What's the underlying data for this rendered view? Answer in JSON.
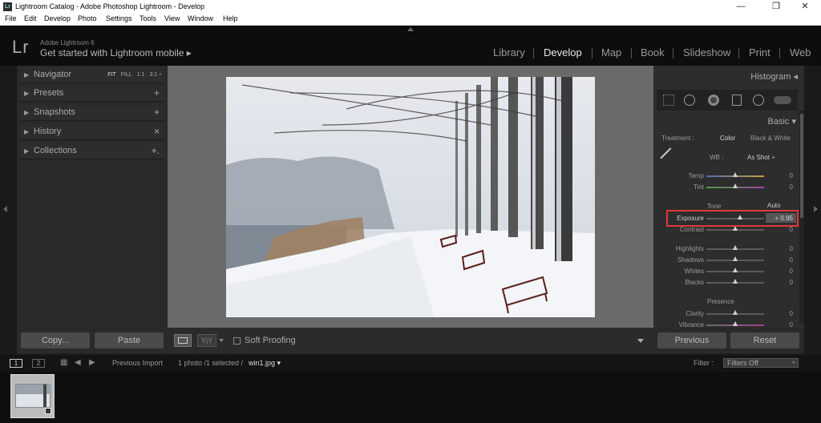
{
  "window": {
    "title": "Lightroom Catalog - Adobe Photoshop Lightroom - Develop"
  },
  "menu": [
    "File",
    "Edit",
    "Develop",
    "Photo",
    "Settings",
    "Tools",
    "View",
    "Window",
    "Help"
  ],
  "identity": {
    "logo": "Lr",
    "product": "Adobe Lightroom 6",
    "tagline": "Get started with Lightroom mobile ▸"
  },
  "modules": [
    "Library",
    "Develop",
    "Map",
    "Book",
    "Slideshow",
    "Print",
    "Web"
  ],
  "active_module": "Develop",
  "left_panel": {
    "navigator": {
      "label": "Navigator",
      "options": [
        "FIT",
        "FILL",
        "1:1",
        "3:1 ÷"
      ]
    },
    "items": [
      {
        "label": "Presets",
        "action": "+"
      },
      {
        "label": "Snapshots",
        "action": "+"
      },
      {
        "label": "History",
        "action": "×"
      },
      {
        "label": "Collections",
        "action": "+."
      }
    ],
    "copy": "Copy...",
    "paste": "Paste"
  },
  "toolbar": {
    "soft_proofing": "Soft Proofing",
    "soft_proofing_checked": false
  },
  "right_panel": {
    "histogram": "Histogram ◂",
    "basic": "Basic ▾",
    "treatment_label": "Treatment :",
    "treatment_color": "Color",
    "treatment_bw": "Black & White",
    "wb_label": "WB :",
    "wb_value": "As Shot ÷",
    "sliders": [
      {
        "label": "Temp",
        "value": "0",
        "pos": 0.5
      },
      {
        "label": "Tint",
        "value": "0",
        "pos": 0.5
      }
    ],
    "tone_label": "Tone",
    "tone_auto": "Auto",
    "exposure": {
      "label": "Exposure",
      "value": "+ 0.95",
      "pos": 0.58
    },
    "tone_sliders": [
      {
        "label": "Contrast",
        "value": "0",
        "pos": 0.5
      },
      {
        "label": "Highlights",
        "value": "0",
        "pos": 0.5
      },
      {
        "label": "Shadows",
        "value": "0",
        "pos": 0.5
      },
      {
        "label": "Whites",
        "value": "0",
        "pos": 0.5
      },
      {
        "label": "Blacks",
        "value": "0",
        "pos": 0.5
      }
    ],
    "presence_label": "Presence",
    "presence_sliders": [
      {
        "label": "Clarity",
        "value": "0",
        "pos": 0.5
      },
      {
        "label": "Vibrance",
        "value": "0",
        "pos": 0.5
      }
    ],
    "previous": "Previous",
    "reset": "Reset"
  },
  "filmstrip": {
    "screen1": "1",
    "screen2": "2",
    "source": "Previous Import",
    "count": "1 photo /1 selected /",
    "filename": "win1.jpg ▾",
    "filter_label": "Filter :",
    "filter_value": "Filters Off"
  }
}
